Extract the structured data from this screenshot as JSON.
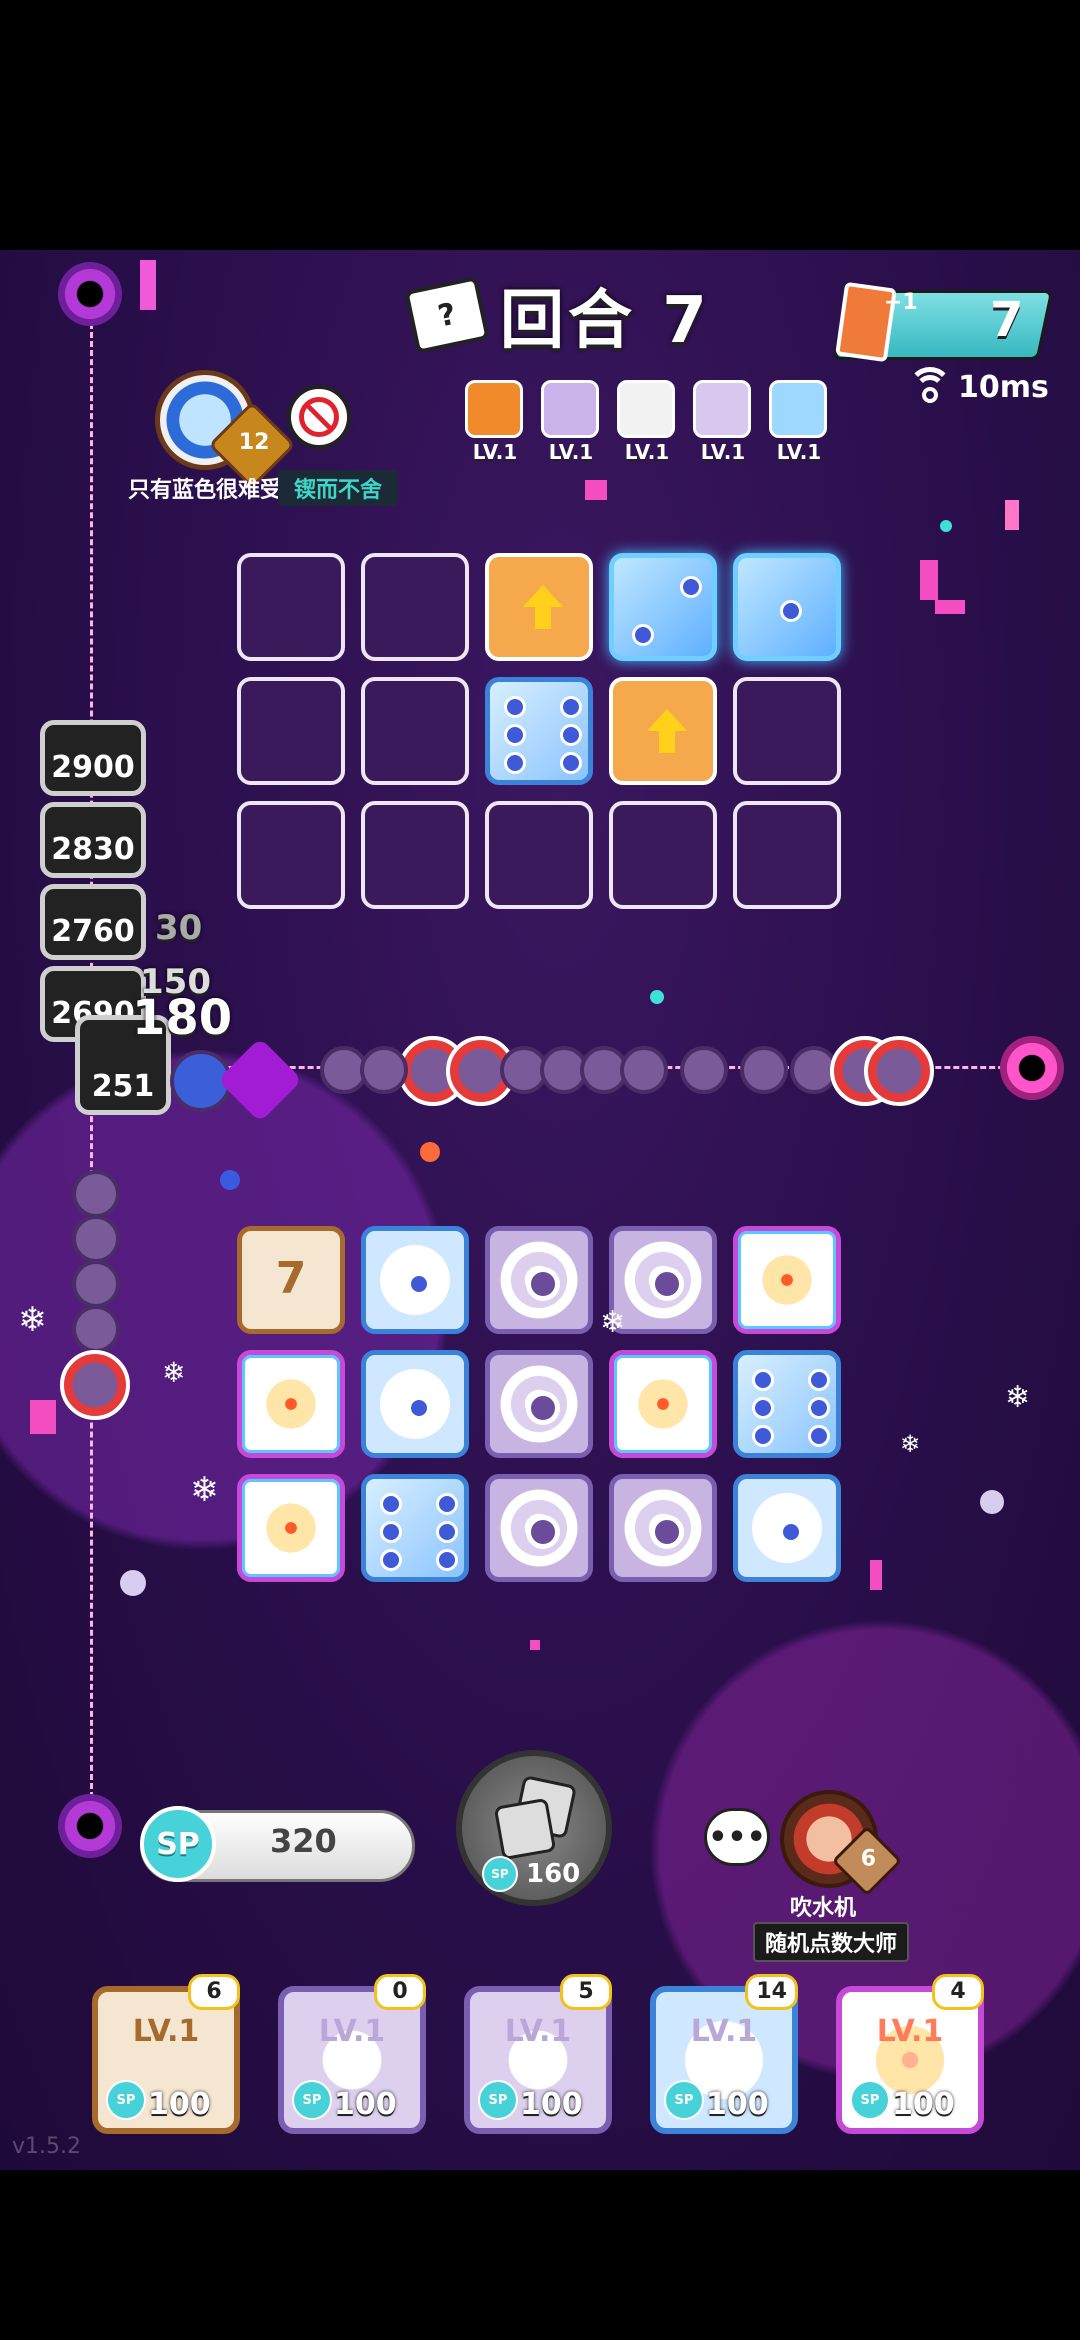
{
  "round": {
    "label": "回合 7"
  },
  "coins": {
    "bonus": "+1",
    "value": "7"
  },
  "ping": {
    "value": "10ms"
  },
  "player": {
    "name": "只有蓝色很难受",
    "title": "锲而不舍",
    "rank": "12"
  },
  "opponent_deck": [
    {
      "name": "fire-die",
      "level": "LV.1",
      "color": "#f08a2a"
    },
    {
      "name": "vortex-die",
      "level": "LV.1",
      "color": "#c9b3ea"
    },
    {
      "name": "infinity-die",
      "level": "LV.1",
      "color": "#f2f2f2"
    },
    {
      "name": "crack-die",
      "level": "LV.1",
      "color": "#d8c8f0"
    },
    {
      "name": "moon-die",
      "level": "LV.1",
      "color": "#9fd8ff"
    }
  ],
  "enemy_board": [
    [
      "empty",
      "empty",
      "upgrade",
      "moon",
      "moon"
    ],
    [
      "empty",
      "empty",
      "ice6",
      "upgrade",
      "empty"
    ],
    [
      "empty",
      "empty",
      "empty",
      "empty",
      "empty"
    ]
  ],
  "my_board": [
    [
      "rand",
      "ice",
      "vortex",
      "vortex",
      "sun"
    ],
    [
      "sun",
      "ice",
      "vortex",
      "sun",
      "ice6"
    ],
    [
      "sun",
      "ice6",
      "vortex",
      "vortex",
      "ice"
    ]
  ],
  "hp_values": [
    "2900",
    "2830",
    "2760",
    "2690",
    "251"
  ],
  "damage_numbers": [
    "180",
    "150",
    "30"
  ],
  "random_die_face": "7",
  "sp": {
    "label": "SP",
    "value": "320"
  },
  "spawn": {
    "cost": "160"
  },
  "opponent": {
    "name": "吹水机",
    "title": "随机点数大师",
    "level": "6"
  },
  "hand": [
    {
      "kind": "rand",
      "level": "LV.1",
      "cost": "100",
      "count": "6"
    },
    {
      "kind": "vortex",
      "level": "LV.1",
      "cost": "100",
      "count": "0"
    },
    {
      "kind": "vortex",
      "level": "LV.1",
      "cost": "100",
      "count": "5"
    },
    {
      "kind": "ice",
      "level": "LV.1",
      "cost": "100",
      "count": "14"
    },
    {
      "kind": "sun",
      "level": "LV.1",
      "cost": "100",
      "count": "4"
    }
  ],
  "version": "v1.5.2"
}
